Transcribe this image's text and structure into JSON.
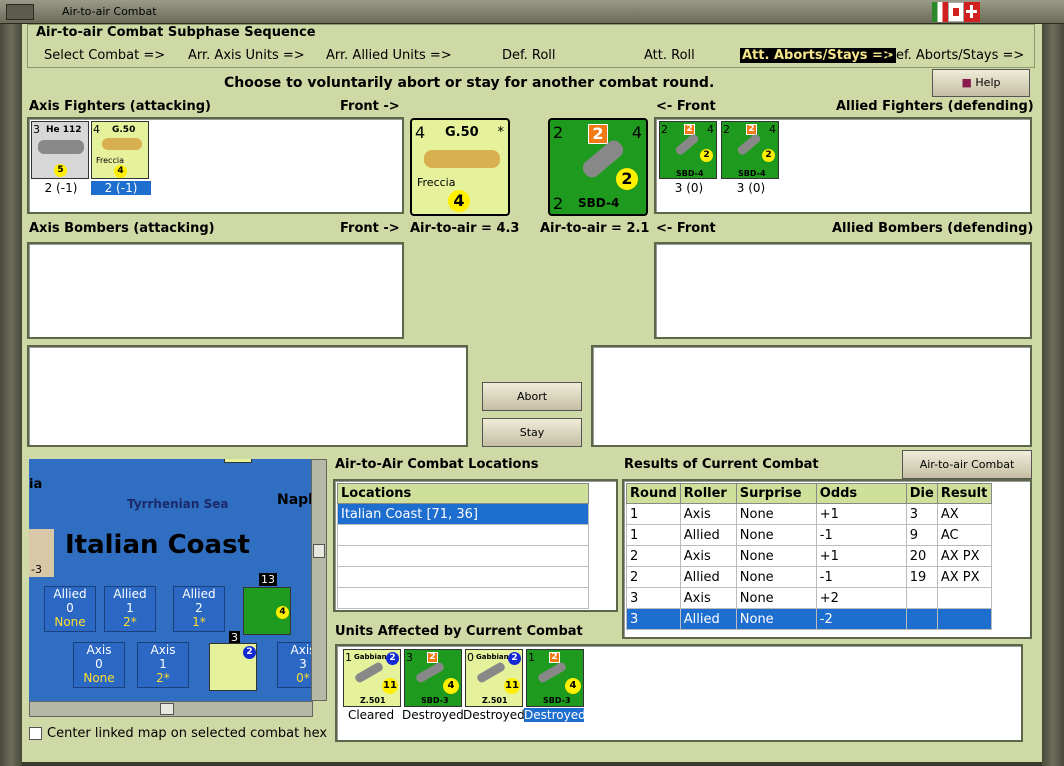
{
  "window": {
    "title": "Air-to-air Combat"
  },
  "sequence": {
    "title": "Air-to-air Combat Subphase Sequence",
    "steps": [
      "Select Combat =>",
      "Arr. Axis Units =>",
      "Arr. Allied Units =>",
      "Def. Roll",
      "Att. Roll",
      "Att. Aborts/Stays =>",
      "Def. Aborts/Stays =>"
    ],
    "active_index": 5
  },
  "help_label": "Help",
  "instruction": "Choose to voluntarily abort or stay for another combat round.",
  "axis_fighters": {
    "label": "Axis Fighters (attacking)",
    "front": "Front ->",
    "units": [
      {
        "name": "He 112",
        "top": "3",
        "value": "5",
        "caption": "2 (-1)",
        "selected": false
      },
      {
        "name": "G.50",
        "subname": "Freccia",
        "top": "4",
        "value": "4",
        "caption": "2 (-1)",
        "selected": true
      }
    ]
  },
  "big_axis": {
    "name": "G.50",
    "subname": "Freccia",
    "top_left": "4",
    "value": "4",
    "stars": "*"
  },
  "big_allied": {
    "name": "SBD-4",
    "top_left": "2",
    "orange": "2",
    "top_right": "4",
    "value": "2",
    "bottom_left": "2"
  },
  "allied_fighters": {
    "label": "Allied Fighters (defending)",
    "front": "<- Front",
    "units": [
      {
        "name": "SBD-4",
        "top": "2",
        "orange": "2",
        "right": "4",
        "value": "2",
        "caption": "3 (0)"
      },
      {
        "name": "SBD-4",
        "top": "2",
        "orange": "2",
        "right": "4",
        "value": "2",
        "caption": "3 (0)"
      }
    ]
  },
  "axis_bombers": {
    "label": "Axis Bombers (attacking)",
    "front": "Front ->"
  },
  "allied_bombers": {
    "label": "Allied Bombers (defending)",
    "front": "<- Front"
  },
  "air_axis": "Air-to-air = 4.3",
  "air_allied": "Air-to-air = 2.1",
  "abort_label": "Abort",
  "stay_label": "Stay",
  "map": {
    "sea": "Tyrrhenian Sea",
    "region": "Italian Coast",
    "naples": "Napl",
    "ia": "ia",
    "stack_count": "13",
    "stack_count2": "3",
    "allied_boxes": [
      {
        "side": "Allied",
        "num": "0",
        "note": "None"
      },
      {
        "side": "Allied",
        "num": "1",
        "note": "2*"
      },
      {
        "side": "Allied",
        "num": "2",
        "note": "1*"
      }
    ],
    "axis_boxes": [
      {
        "side": "Axis",
        "num": "0",
        "note": "None"
      },
      {
        "side": "Axis",
        "num": "1",
        "note": "2*"
      },
      {
        "side": "Axis",
        "num": "3",
        "note": "0*"
      }
    ],
    "edge_num": "-3"
  },
  "center_link": "Center linked map on selected combat hex",
  "locations": {
    "title": "Air-to-Air Combat Locations",
    "header": "Locations",
    "rows": [
      "Italian Coast [71, 36]"
    ]
  },
  "results": {
    "title": "Results of Current Combat",
    "chart_button": "Air-to-air Combat Chart",
    "headers": [
      "Round",
      "Roller",
      "Surprise",
      "Odds",
      "Die",
      "Result"
    ],
    "rows": [
      [
        "1",
        "Axis",
        "None",
        "+1",
        "3",
        "AX"
      ],
      [
        "1",
        "Allied",
        "None",
        "-1",
        "9",
        "AC"
      ],
      [
        "2",
        "Axis",
        "None",
        "+1",
        "20",
        "AX PX"
      ],
      [
        "2",
        "Allied",
        "None",
        "-1",
        "19",
        "AX PX"
      ],
      [
        "3",
        "Axis",
        "None",
        "+2",
        "",
        ""
      ],
      [
        "3",
        "Allied",
        "None",
        "-2",
        "",
        ""
      ]
    ],
    "selected_row": 5
  },
  "affected": {
    "title": "Units Affected by Current Combat",
    "units": [
      {
        "name": "Z.501",
        "subname": "Gabbiano",
        "top": "1",
        "blue": "2",
        "value": "11",
        "caption": "Cleared",
        "color": "yellow"
      },
      {
        "name": "SBD-3",
        "top": "3",
        "orange": "2",
        "value": "4",
        "caption": "Destroyed",
        "color": "green"
      },
      {
        "name": "Z.501",
        "subname": "Gabbiano",
        "top": "0",
        "blue": "2",
        "value": "11",
        "caption": "Destroyed",
        "color": "yellow"
      },
      {
        "name": "SBD-3",
        "top": "1",
        "orange": "2",
        "value": "4",
        "caption": "Destroyed",
        "color": "green"
      }
    ]
  },
  "colors": {
    "background": "#cfd9a6",
    "selected": "#1e6ed0",
    "active_step_bg": "#000000",
    "active_step_fg": "#f6e58a"
  }
}
